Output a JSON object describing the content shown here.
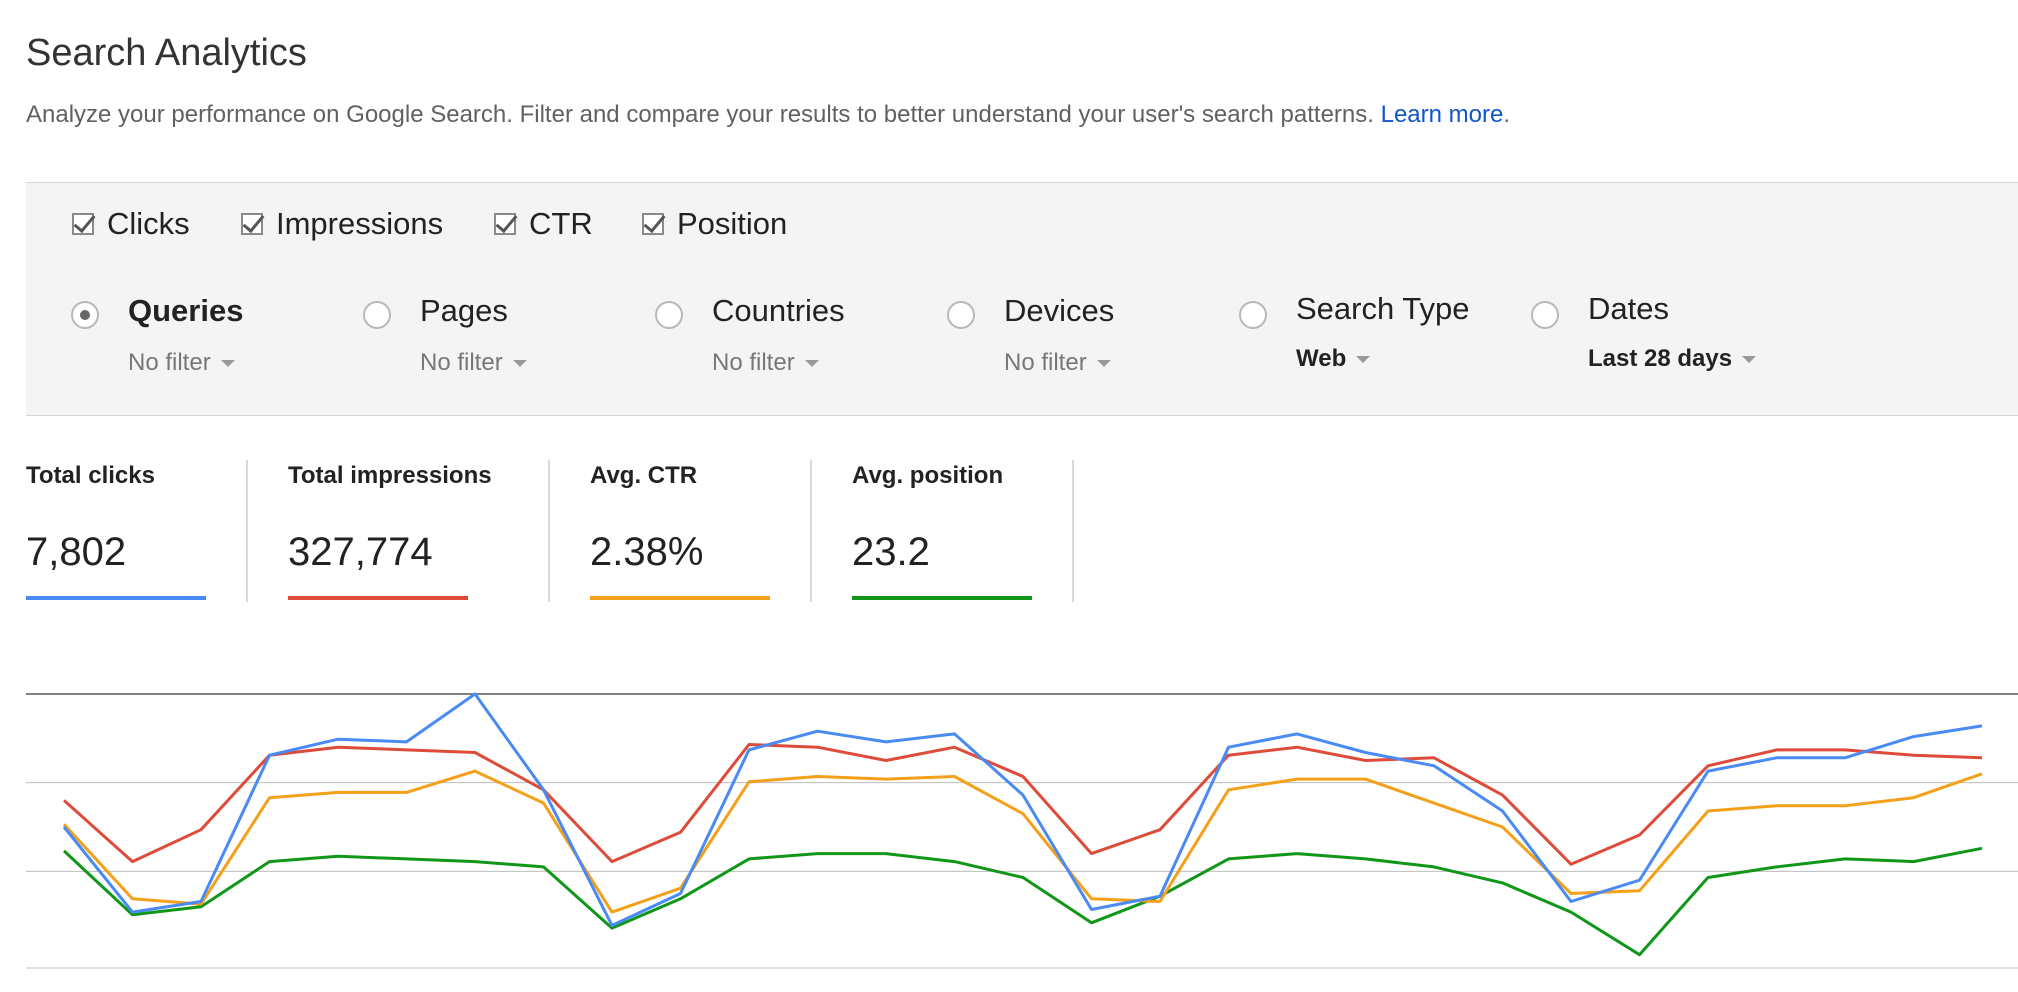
{
  "header": {
    "title": "Search Analytics",
    "description": "Analyze your performance on Google Search. Filter and compare your results to better understand your user's search patterns.",
    "learn_more": "Learn more",
    "period": "."
  },
  "metrics": [
    {
      "label": "Clicks",
      "checked": true
    },
    {
      "label": "Impressions",
      "checked": true
    },
    {
      "label": "CTR",
      "checked": true
    },
    {
      "label": "Position",
      "checked": true
    }
  ],
  "dimensions": [
    {
      "label": "Queries",
      "filter": "No filter",
      "selected": true
    },
    {
      "label": "Pages",
      "filter": "No filter",
      "selected": false
    },
    {
      "label": "Countries",
      "filter": "No filter",
      "selected": false
    },
    {
      "label": "Devices",
      "filter": "No filter",
      "selected": false
    },
    {
      "label": "Search Type",
      "filter": "Web",
      "selected": false
    },
    {
      "label": "Dates",
      "filter": "Last 28 days",
      "selected": false
    }
  ],
  "totals": [
    {
      "label": "Total clicks",
      "value": "7,802",
      "color": "#4a8af4"
    },
    {
      "label": "Total impressions",
      "value": "327,774",
      "color": "#dd4b39"
    },
    {
      "label": "Avg. CTR",
      "value": "2.38%",
      "color": "#f4a01a"
    },
    {
      "label": "Avg. position",
      "value": "23.2",
      "color": "#109618"
    }
  ],
  "chart_data": {
    "type": "line",
    "title": "",
    "xlabel": "",
    "ylabel": "",
    "ylim": [
      0,
      100
    ],
    "grid": true,
    "legend": "none",
    "x": [
      1,
      2,
      3,
      4,
      5,
      6,
      7,
      8,
      9,
      10,
      11,
      12,
      13,
      14,
      15,
      16,
      17,
      18,
      19,
      20,
      21,
      22,
      23,
      24,
      25,
      26,
      27,
      28,
      29
    ],
    "series": [
      {
        "color": "#4a8af4",
        "values": [
          50,
          18,
          22,
          77,
          83,
          82,
          100,
          64,
          13,
          25,
          79,
          86,
          82,
          85,
          62,
          19,
          24,
          80,
          85,
          78,
          73,
          56,
          22,
          30,
          71,
          76,
          76,
          84,
          88
        ]
      },
      {
        "color": "#dd4b39",
        "values": [
          60,
          37,
          49,
          77,
          80,
          79,
          78,
          64,
          37,
          48,
          81,
          80,
          75,
          80,
          69,
          40,
          49,
          77,
          80,
          75,
          76,
          62,
          36,
          47,
          73,
          79,
          79,
          77,
          76
        ]
      },
      {
        "color": "#f4a01a",
        "values": [
          51,
          23,
          21,
          61,
          63,
          63,
          71,
          59,
          18,
          27,
          67,
          69,
          68,
          69,
          55,
          23,
          22,
          64,
          68,
          68,
          59,
          50,
          25,
          26,
          56,
          58,
          58,
          61,
          70
        ]
      },
      {
        "color": "#109618",
        "values": [
          41,
          17,
          20,
          37,
          39,
          38,
          37,
          35,
          12,
          23,
          38,
          40,
          40,
          37,
          31,
          14,
          24,
          38,
          40,
          38,
          35,
          29,
          18,
          2,
          31,
          35,
          38,
          37,
          42
        ]
      }
    ]
  }
}
